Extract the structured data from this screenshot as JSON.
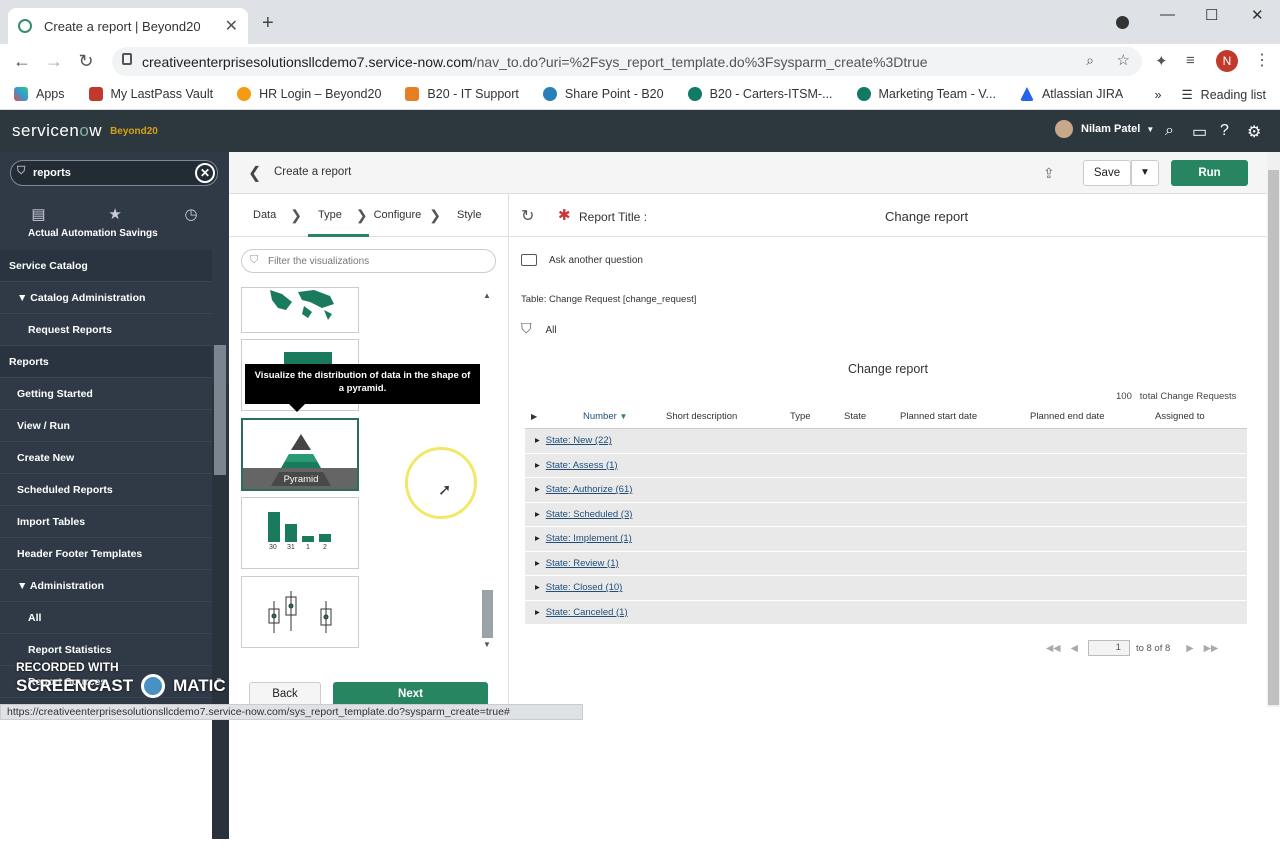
{
  "browser": {
    "tab_title": "Create a report | Beyond20",
    "url_host": "creativeenterprisesolutionsllcdemo7.service-now.com",
    "url_path": "/nav_to.do?uri=%2Fsys_report_template.do%3Fsysparm_create%3Dtrue",
    "bookmarks": [
      "Apps",
      "My LastPass Vault",
      "HR Login – Beyond20",
      "B20 - IT Support",
      "Share Point - B20",
      "B20 - Carters-ITSM-...",
      "Marketing Team - V...",
      "Atlassian JIRA"
    ],
    "reading_list": "Reading list",
    "profile_initial": "N",
    "status_url": "https://creativeenterprisesolutionsllcdemo7.service-now.com/sys_report_template.do?sysparm_create=true#"
  },
  "header": {
    "logo_a": "servicen",
    "logo_o": "o",
    "logo_b": "w",
    "instance": "Beyond20",
    "user": "Nilam Patel"
  },
  "sidebar": {
    "filter_value": "reports",
    "top_partial": "Actual Automation Savings",
    "items": [
      {
        "label": "Service Catalog",
        "kind": "sec"
      },
      {
        "label": "▼ Catalog Administration",
        "kind": "l1"
      },
      {
        "label": "Request Reports",
        "kind": "l2"
      },
      {
        "label": "Reports",
        "kind": "sec"
      },
      {
        "label": "Getting Started",
        "kind": "l1"
      },
      {
        "label": "View / Run",
        "kind": "l1"
      },
      {
        "label": "Create New",
        "kind": "l1"
      },
      {
        "label": "Scheduled Reports",
        "kind": "l1"
      },
      {
        "label": "Import Tables",
        "kind": "l1"
      },
      {
        "label": "Header Footer Templates",
        "kind": "l1"
      },
      {
        "label": "▼ Administration",
        "kind": "l1"
      },
      {
        "label": "All",
        "kind": "l2"
      },
      {
        "label": "Report Statistics",
        "kind": "l2"
      },
      {
        "label": "Report Sources",
        "kind": "l2"
      }
    ],
    "watermark_line1": "RECORDED WITH",
    "watermark_line2": "SCREENCAST",
    "watermark_line3": "MATIC"
  },
  "toolbar": {
    "breadcrumb": "Create a report",
    "save_label": "Save",
    "run_label": "Run"
  },
  "wizard": {
    "steps": [
      "Data",
      "Type",
      "Configure",
      "Style"
    ],
    "active_step": "Type",
    "filter_placeholder": "Filter the visualizations",
    "tooltip": "Visualize the distribution of data in the shape of a pyramid.",
    "pyramid_label": "Pyramid",
    "bar_labels": [
      "30",
      "31",
      "1",
      "2"
    ],
    "back_label": "Back",
    "next_label": "Next"
  },
  "preview": {
    "report_title_label": "Report Title :",
    "report_title_value": "Change report",
    "ask_label": "Ask another question",
    "table_label": "Table: Change Request [change_request]",
    "filter_label": "All",
    "chart_title": "Change report",
    "total_count": "100",
    "total_label": "total Change Requests",
    "columns": [
      "Number",
      "Short description",
      "Type",
      "State",
      "Planned start date",
      "Planned end date",
      "Assigned to"
    ],
    "groups": [
      "State: New (22)",
      "State: Assess (1)",
      "State: Authorize (61)",
      "State: Scheduled (3)",
      "State: Implement (1)",
      "State: Review (1)",
      "State: Closed (10)",
      "State: Canceled (1)"
    ],
    "page_value": "1",
    "page_suffix": "to 8 of 8"
  },
  "colors": {
    "accent": "#278661",
    "sidebar": "#303a46",
    "header": "#2d383e"
  }
}
